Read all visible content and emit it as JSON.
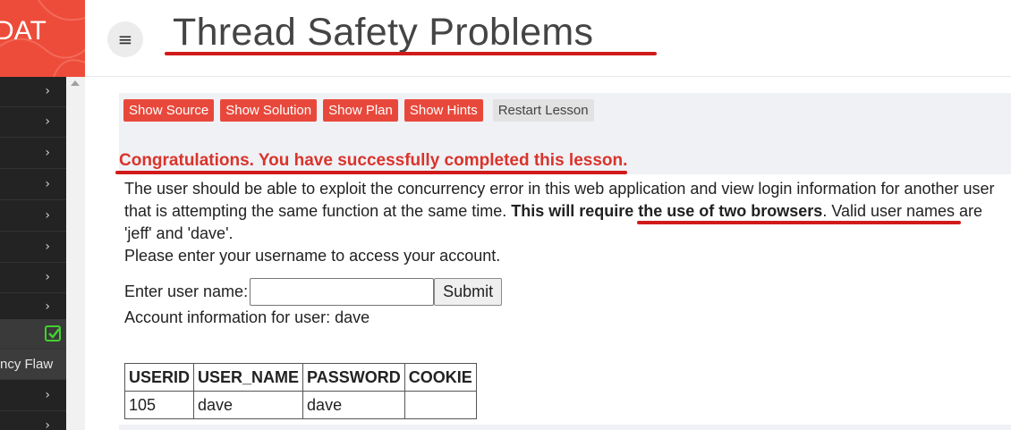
{
  "brand": {
    "text": "DAT",
    "color": "#ee4c3a"
  },
  "header": {
    "menu_icon": "≡",
    "title": "Thread Safety Problems"
  },
  "sidebar": {
    "chevron": "›",
    "active_item_check": "check-icon",
    "sub_item_label": "ncy Flaw"
  },
  "toolbar": {
    "show_source": "Show Source",
    "show_solution": "Show Solution",
    "show_plan": "Show Plan",
    "show_hints": "Show Hints",
    "restart_lesson": "Restart Lesson"
  },
  "lesson": {
    "congrats": "Congratulations. You have successfully completed this lesson.",
    "desc_part1": "The user should be able to exploit the concurrency error in this web application and view login information for another user that is attempting the same function at the same time. ",
    "desc_bold": "This will require the use of two browsers",
    "desc_part2": ". Valid user names are 'jeff' and 'dave'.",
    "desc_line2": "Please enter your username to access your account.",
    "form_label": "Enter user name:",
    "input_value": "",
    "submit_label": "Submit",
    "account_info": "Account information for user: dave"
  },
  "table": {
    "headers": [
      "USERID",
      "USER_NAME",
      "PASSWORD",
      "COOKIE"
    ],
    "rows": [
      [
        "105",
        "dave",
        "dave",
        ""
      ]
    ]
  },
  "colors": {
    "accent_red": "#e8483b",
    "annotation_red": "#d11a1a",
    "success_green": "#41d12e"
  }
}
